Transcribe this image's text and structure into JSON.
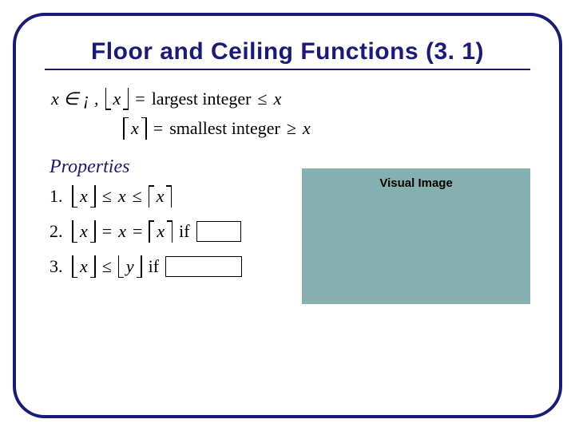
{
  "title": "Floor and Ceiling Functions (3. 1)",
  "defs": {
    "domain_prefix": "x ∈ ¡ ,",
    "floor_var": "x",
    "floor_eq": "=",
    "floor_text": "largest integer",
    "floor_rel": "≤",
    "floor_rhs": "x",
    "ceil_var": "x",
    "ceil_eq": "=",
    "ceil_text": "smallest integer",
    "ceil_rel": "≥",
    "ceil_rhs": "x"
  },
  "properties_label": "Properties",
  "props": {
    "p1": {
      "num": "1.",
      "a": "x",
      "rel1": "≤",
      "mid": "x",
      "rel2": "≤",
      "c": "x"
    },
    "p2": {
      "num": "2.",
      "a": "x",
      "eq1": "=",
      "mid": "x",
      "eq2": "=",
      "c": "x",
      "if": "if"
    },
    "p3": {
      "num": "3.",
      "a": "x",
      "rel": "≤",
      "b": "y",
      "if": "if"
    }
  },
  "visual_label": "Visual Image"
}
